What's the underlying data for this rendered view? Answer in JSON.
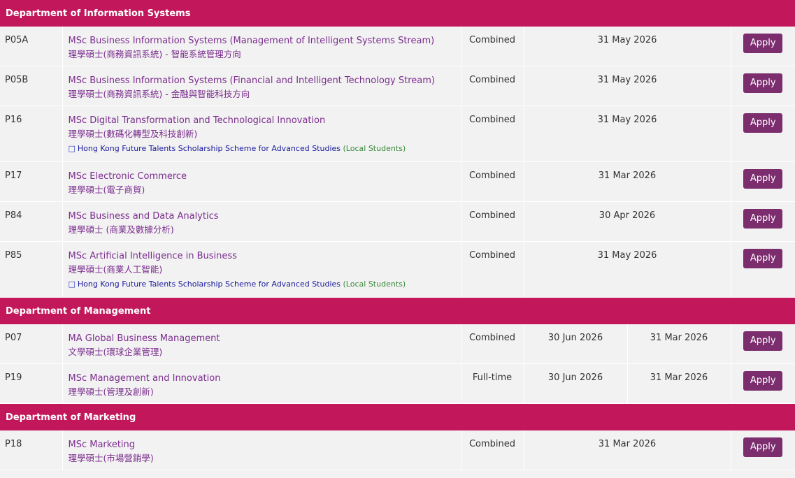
{
  "apply_label": "Apply",
  "scholarship": {
    "bookmark_icon": "bookmark-icon",
    "part1": "Hong Kong Future Talents Scholarship Scheme for Advanced Studies",
    "part2": "(Local Students)"
  },
  "departments": [
    {
      "name": "Department of Information Systems",
      "programmes": [
        {
          "code": "P05A",
          "title_en": "MSc Business Information Systems (Management of Intelligent Systems Stream)",
          "title_zh": "理學碩士(商務資訊系統) - 智能系統管理方向",
          "mode": "Combined",
          "deadline": "31 May 2026"
        },
        {
          "code": "P05B",
          "title_en": "MSc Business Information Systems (Financial and Intelligent Technology Stream)",
          "title_zh": "理學碩士(商務資訊系統) - 金融與智能科技方向",
          "mode": "Combined",
          "deadline": "31 May 2026"
        },
        {
          "code": "P16",
          "title_en": "MSc Digital Transformation and Technological Innovation",
          "title_zh": "理學碩士(數碼化轉型及科技創新)",
          "mode": "Combined",
          "deadline": "31 May 2026"
        },
        {
          "code": "P17",
          "title_en": "MSc Electronic Commerce",
          "title_zh": "理學碩士(電子商貿)",
          "mode": "Combined",
          "deadline": "31 Mar 2026"
        },
        {
          "code": "P84",
          "title_en": "MSc Business and Data Analytics",
          "title_zh": "理學碩士 (商業及數據分析)",
          "mode": "Combined",
          "deadline": "30 Apr 2026"
        },
        {
          "code": "P85",
          "title_en": "MSc Artificial Intelligence in Business",
          "title_zh": "理學碩士(商業人工智能)",
          "mode": "Combined",
          "deadline": "31 May 2026"
        }
      ]
    },
    {
      "name": "Department of Management",
      "programmes": [
        {
          "code": "P07",
          "title_en": "MA Global Business Management",
          "title_zh": "文學碩士(環球企業管理)",
          "mode": "Combined",
          "date1": "30 Jun 2026",
          "date2": "31 Mar 2026"
        },
        {
          "code": "P19",
          "title_en": "MSc Management and Innovation",
          "title_zh": "理學碩士(管理及創新)",
          "mode": "Full-time",
          "date1": "30 Jun 2026",
          "date2": "31 Mar 2026"
        }
      ]
    },
    {
      "name": "Department of Marketing",
      "programmes": [
        {
          "code": "P18",
          "title_en": "MSc Marketing",
          "title_zh": "理學碩士(市場營銷學)",
          "mode": "Combined",
          "deadline": "31 Mar 2026"
        }
      ]
    }
  ]
}
